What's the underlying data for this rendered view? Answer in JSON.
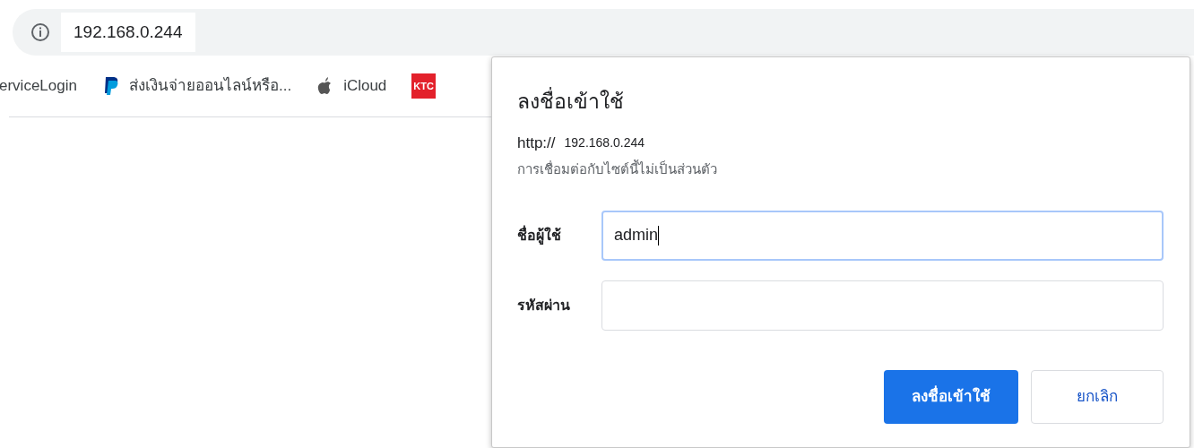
{
  "address_bar": {
    "url": "192.168.0.244"
  },
  "bookmarks": [
    {
      "kind": "text",
      "label": "erviceLogin"
    },
    {
      "kind": "paypal",
      "label": "ส่งเงินจ่ายออนไลน์หรือ..."
    },
    {
      "kind": "apple",
      "label": "iCloud"
    },
    {
      "kind": "badge",
      "label": "KTC"
    }
  ],
  "dialog": {
    "title": "ลงชื่อเข้าใช้",
    "scheme": "http://",
    "host": "192.168.0.244",
    "note": "การเชื่อมต่อกับไซต์นี้ไม่เป็นส่วนตัว",
    "fields": [
      {
        "label": "ชื่อผู้ใช้",
        "value": "admin",
        "focused": true
      },
      {
        "label": "รหัสผ่าน",
        "focused": false
      }
    ],
    "buttons": [
      {
        "label": "ลงชื่อเข้าใช้",
        "kind": "primary"
      },
      {
        "label": "ยกเลิก",
        "kind": "secondary"
      }
    ]
  }
}
